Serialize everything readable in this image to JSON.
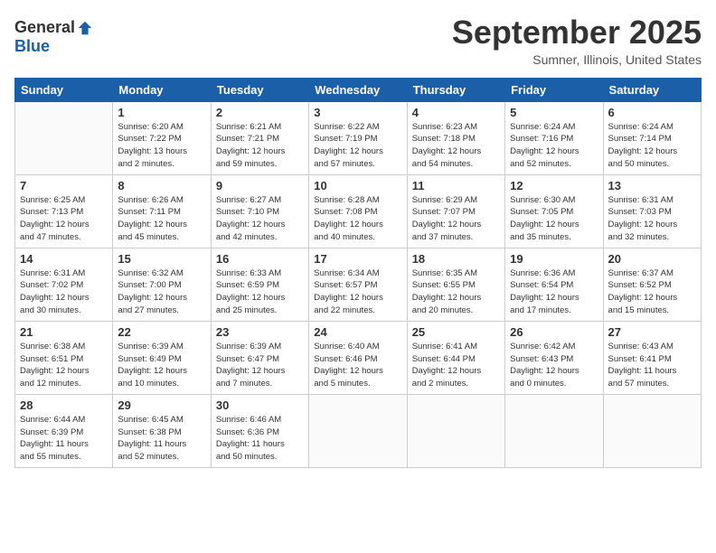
{
  "logo": {
    "general": "General",
    "blue": "Blue"
  },
  "header": {
    "title": "September 2025",
    "subtitle": "Sumner, Illinois, United States"
  },
  "weekdays": [
    "Sunday",
    "Monday",
    "Tuesday",
    "Wednesday",
    "Thursday",
    "Friday",
    "Saturday"
  ],
  "weeks": [
    [
      {
        "day": "",
        "info": ""
      },
      {
        "day": "1",
        "info": "Sunrise: 6:20 AM\nSunset: 7:22 PM\nDaylight: 13 hours\nand 2 minutes."
      },
      {
        "day": "2",
        "info": "Sunrise: 6:21 AM\nSunset: 7:21 PM\nDaylight: 12 hours\nand 59 minutes."
      },
      {
        "day": "3",
        "info": "Sunrise: 6:22 AM\nSunset: 7:19 PM\nDaylight: 12 hours\nand 57 minutes."
      },
      {
        "day": "4",
        "info": "Sunrise: 6:23 AM\nSunset: 7:18 PM\nDaylight: 12 hours\nand 54 minutes."
      },
      {
        "day": "5",
        "info": "Sunrise: 6:24 AM\nSunset: 7:16 PM\nDaylight: 12 hours\nand 52 minutes."
      },
      {
        "day": "6",
        "info": "Sunrise: 6:24 AM\nSunset: 7:14 PM\nDaylight: 12 hours\nand 50 minutes."
      }
    ],
    [
      {
        "day": "7",
        "info": "Sunrise: 6:25 AM\nSunset: 7:13 PM\nDaylight: 12 hours\nand 47 minutes."
      },
      {
        "day": "8",
        "info": "Sunrise: 6:26 AM\nSunset: 7:11 PM\nDaylight: 12 hours\nand 45 minutes."
      },
      {
        "day": "9",
        "info": "Sunrise: 6:27 AM\nSunset: 7:10 PM\nDaylight: 12 hours\nand 42 minutes."
      },
      {
        "day": "10",
        "info": "Sunrise: 6:28 AM\nSunset: 7:08 PM\nDaylight: 12 hours\nand 40 minutes."
      },
      {
        "day": "11",
        "info": "Sunrise: 6:29 AM\nSunset: 7:07 PM\nDaylight: 12 hours\nand 37 minutes."
      },
      {
        "day": "12",
        "info": "Sunrise: 6:30 AM\nSunset: 7:05 PM\nDaylight: 12 hours\nand 35 minutes."
      },
      {
        "day": "13",
        "info": "Sunrise: 6:31 AM\nSunset: 7:03 PM\nDaylight: 12 hours\nand 32 minutes."
      }
    ],
    [
      {
        "day": "14",
        "info": "Sunrise: 6:31 AM\nSunset: 7:02 PM\nDaylight: 12 hours\nand 30 minutes."
      },
      {
        "day": "15",
        "info": "Sunrise: 6:32 AM\nSunset: 7:00 PM\nDaylight: 12 hours\nand 27 minutes."
      },
      {
        "day": "16",
        "info": "Sunrise: 6:33 AM\nSunset: 6:59 PM\nDaylight: 12 hours\nand 25 minutes."
      },
      {
        "day": "17",
        "info": "Sunrise: 6:34 AM\nSunset: 6:57 PM\nDaylight: 12 hours\nand 22 minutes."
      },
      {
        "day": "18",
        "info": "Sunrise: 6:35 AM\nSunset: 6:55 PM\nDaylight: 12 hours\nand 20 minutes."
      },
      {
        "day": "19",
        "info": "Sunrise: 6:36 AM\nSunset: 6:54 PM\nDaylight: 12 hours\nand 17 minutes."
      },
      {
        "day": "20",
        "info": "Sunrise: 6:37 AM\nSunset: 6:52 PM\nDaylight: 12 hours\nand 15 minutes."
      }
    ],
    [
      {
        "day": "21",
        "info": "Sunrise: 6:38 AM\nSunset: 6:51 PM\nDaylight: 12 hours\nand 12 minutes."
      },
      {
        "day": "22",
        "info": "Sunrise: 6:39 AM\nSunset: 6:49 PM\nDaylight: 12 hours\nand 10 minutes."
      },
      {
        "day": "23",
        "info": "Sunrise: 6:39 AM\nSunset: 6:47 PM\nDaylight: 12 hours\nand 7 minutes."
      },
      {
        "day": "24",
        "info": "Sunrise: 6:40 AM\nSunset: 6:46 PM\nDaylight: 12 hours\nand 5 minutes."
      },
      {
        "day": "25",
        "info": "Sunrise: 6:41 AM\nSunset: 6:44 PM\nDaylight: 12 hours\nand 2 minutes."
      },
      {
        "day": "26",
        "info": "Sunrise: 6:42 AM\nSunset: 6:43 PM\nDaylight: 12 hours\nand 0 minutes."
      },
      {
        "day": "27",
        "info": "Sunrise: 6:43 AM\nSunset: 6:41 PM\nDaylight: 11 hours\nand 57 minutes."
      }
    ],
    [
      {
        "day": "28",
        "info": "Sunrise: 6:44 AM\nSunset: 6:39 PM\nDaylight: 11 hours\nand 55 minutes."
      },
      {
        "day": "29",
        "info": "Sunrise: 6:45 AM\nSunset: 6:38 PM\nDaylight: 11 hours\nand 52 minutes."
      },
      {
        "day": "30",
        "info": "Sunrise: 6:46 AM\nSunset: 6:36 PM\nDaylight: 11 hours\nand 50 minutes."
      },
      {
        "day": "",
        "info": ""
      },
      {
        "day": "",
        "info": ""
      },
      {
        "day": "",
        "info": ""
      },
      {
        "day": "",
        "info": ""
      }
    ]
  ]
}
